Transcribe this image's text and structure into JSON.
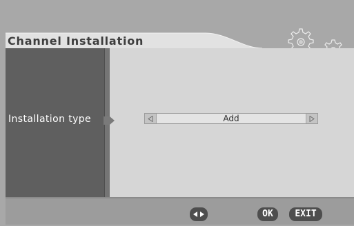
{
  "header": {
    "title": "Channel Installation"
  },
  "settings": [
    {
      "label": "Installation type",
      "value": "Add"
    }
  ],
  "footer": {
    "nav_icon": "left-right-arrows-icon",
    "ok_label": "OK",
    "exit_label": "EXIT"
  },
  "icons": {
    "gears": "gears-icon",
    "pointer": "selection-pointer-icon",
    "left": "triangle-left-icon",
    "right": "triangle-right-icon"
  },
  "colors": {
    "background": "#a8a8a8",
    "left_panel": "#5f5f5f",
    "content": "#d6d6d6",
    "button": "#4e4e4e"
  }
}
